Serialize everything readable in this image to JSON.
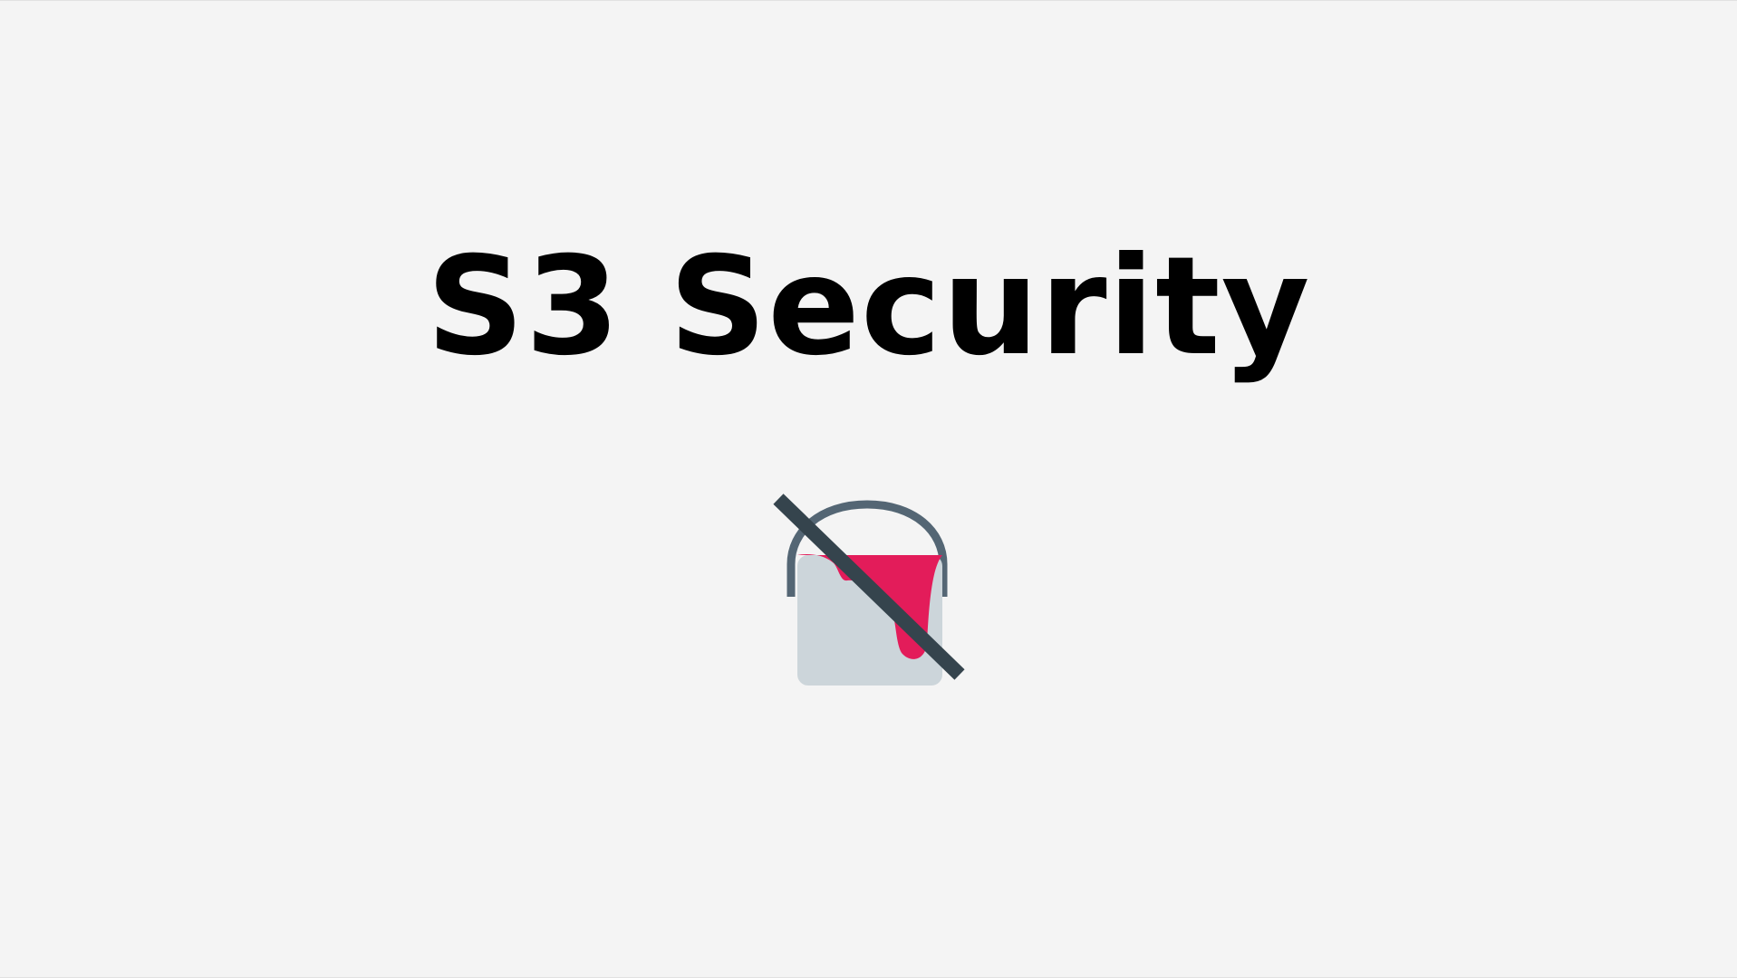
{
  "slide": {
    "title": "S3 Security",
    "icon": "no-paint-bucket-icon"
  },
  "colors": {
    "background": "#f4f4f4",
    "title": "#000000",
    "bucket_body": "#ccd5da",
    "bucket_handle": "#546674",
    "paint": "#e31c5a",
    "strike": "#35444d"
  }
}
